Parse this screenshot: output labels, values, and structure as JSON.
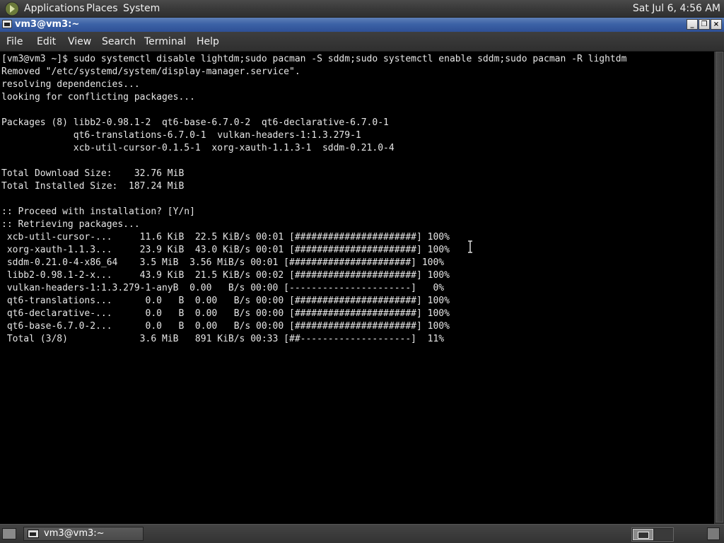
{
  "top_panel": {
    "menus": [
      "Applications",
      "Places",
      "System"
    ],
    "clock": "Sat Jul  6,  4:56 AM",
    "apps_icon": "gnome-foot-icon"
  },
  "window": {
    "title": "vm3@vm3:~",
    "buttons": {
      "minimize": "_",
      "maximize": "❐",
      "close": "×"
    }
  },
  "menubar": [
    "File",
    "Edit",
    "View",
    "Search",
    "Terminal",
    "Help"
  ],
  "terminal": {
    "lines": [
      "[vm3@vm3 ~]$ sudo systemctl disable lightdm;sudo pacman -S sddm;sudo systemctl enable sddm;sudo pacman -R lightdm",
      "Removed \"/etc/systemd/system/display-manager.service\".",
      "resolving dependencies...",
      "looking for conflicting packages...",
      "",
      "Packages (8) libb2-0.98.1-2  qt6-base-6.7.0-2  qt6-declarative-6.7.0-1",
      "             qt6-translations-6.7.0-1  vulkan-headers-1:1.3.279-1",
      "             xcb-util-cursor-0.1.5-1  xorg-xauth-1.1.3-1  sddm-0.21.0-4",
      "",
      "Total Download Size:    32.76 MiB",
      "Total Installed Size:  187.24 MiB",
      "",
      ":: Proceed with installation? [Y/n]",
      ":: Retrieving packages...",
      " xcb-util-cursor-...     11.6 KiB  22.5 KiB/s 00:01 [######################] 100%",
      " xorg-xauth-1.1.3...     23.9 KiB  43.0 KiB/s 00:01 [######################] 100%",
      " sddm-0.21.0-4-x86_64    3.5 MiB  3.56 MiB/s 00:01 [######################] 100%",
      " libb2-0.98.1-2-x...     43.9 KiB  21.5 KiB/s 00:02 [######################] 100%",
      " vulkan-headers-1:1.3.279-1-anyB  0.00   B/s 00:00 [----------------------]   0%",
      " qt6-translations...      0.0   B  0.00   B/s 00:00 [######################] 100%",
      " qt6-declarative-...      0.0   B  0.00   B/s 00:00 [######################] 100%",
      " qt6-base-6.7.0-2...      0.0   B  0.00   B/s 00:00 [######################] 100%",
      " Total (3/8)             3.6 MiB   891 KiB/s 00:33 [##--------------------]  11%"
    ]
  },
  "taskbar": {
    "task_label": "vm3@vm3:~"
  }
}
